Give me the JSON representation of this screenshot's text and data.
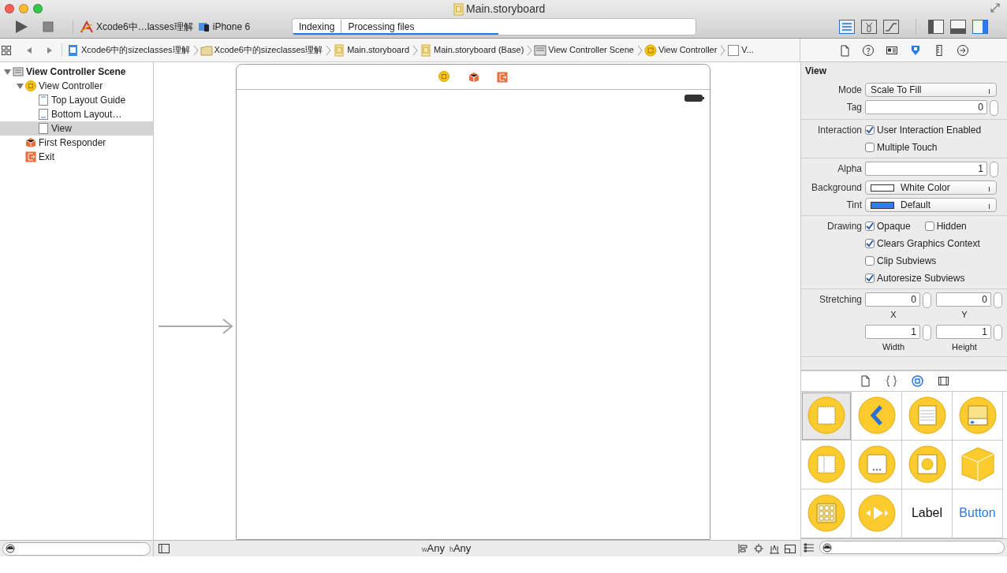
{
  "window": {
    "title": "Main.storyboard"
  },
  "toolbar": {
    "scheme": "Xcode6中…lasses理解",
    "device": "iPhone 6",
    "activity": {
      "task": "Indexing",
      "detail": "Processing files",
      "level": 0.51
    },
    "editor_modes": [
      {
        "kind": "standard",
        "selected": true
      },
      {
        "kind": "assistant",
        "selected": false
      },
      {
        "kind": "version",
        "selected": false
      }
    ],
    "panels": [
      {
        "kind": "navigator",
        "on": false
      },
      {
        "kind": "debug",
        "on": false
      },
      {
        "kind": "utilities",
        "on": true
      }
    ]
  },
  "jump_bar": [
    {
      "kind": "project",
      "text": "Xcode6中的sizeclasses理解"
    },
    {
      "kind": "folder",
      "text": "Xcode6中的sizeclasses理解"
    },
    {
      "kind": "storyboard",
      "text": "Main.storyboard"
    },
    {
      "kind": "storyboard",
      "text": "Main.storyboard (Base)"
    },
    {
      "kind": "scene",
      "text": "View Controller Scene"
    },
    {
      "kind": "controller",
      "text": "View Controller"
    },
    {
      "kind": "view",
      "text": "V..."
    }
  ],
  "inspector_tabs": [
    {
      "kind": "file",
      "selected": false
    },
    {
      "kind": "help",
      "selected": false
    },
    {
      "kind": "identity",
      "selected": false
    },
    {
      "kind": "attributes",
      "selected": true
    },
    {
      "kind": "size",
      "selected": false
    },
    {
      "kind": "connections",
      "selected": false
    }
  ],
  "outline": [
    {
      "kind": "scene",
      "text": "View Controller Scene",
      "expanded": true,
      "selected": false,
      "children": [
        {
          "kind": "controller",
          "text": "View Controller",
          "expanded": true,
          "selected": false,
          "children": [
            {
              "kind": "top-guide",
              "text": "Top Layout Guide",
              "selected": false
            },
            {
              "kind": "bottom-guide",
              "text": "Bottom Layout…",
              "selected": false
            },
            {
              "kind": "view",
              "text": "View",
              "selected": true
            }
          ]
        },
        {
          "kind": "responder",
          "text": "First Responder",
          "selected": false
        },
        {
          "kind": "exit",
          "text": "Exit",
          "selected": false
        }
      ]
    }
  ],
  "canvas": {
    "size_class": {
      "w_mark": "w",
      "width": "Any",
      "h_mark": "h",
      "height": "Any"
    }
  },
  "inspector": {
    "title": "View",
    "groups": [
      [
        {
          "kind": "popup",
          "label": "Mode",
          "value": "Scale To Fill"
        },
        {
          "kind": "stepper",
          "label": "Tag",
          "value": "0"
        }
      ],
      [
        {
          "kind": "checks",
          "label": "Interaction",
          "items": [
            {
              "text": "User Interaction Enabled",
              "checked": true
            }
          ]
        },
        {
          "kind": "checks",
          "items": [
            {
              "text": "Multiple Touch",
              "checked": false
            }
          ]
        }
      ],
      [
        {
          "kind": "stepper",
          "label": "Alpha",
          "value": "1"
        },
        {
          "kind": "popup",
          "label": "Background",
          "value": "White Color",
          "color": "#ffffff"
        },
        {
          "kind": "popup",
          "label": "Tint",
          "value": "Default",
          "color": "#2f80ed"
        }
      ],
      [
        {
          "kind": "checks",
          "label": "Drawing",
          "items": [
            {
              "text": "Opaque",
              "checked": true
            },
            {
              "text": "Hidden",
              "checked": false
            }
          ]
        },
        {
          "kind": "checks",
          "items": [
            {
              "text": "Clears Graphics Context",
              "checked": true
            }
          ]
        },
        {
          "kind": "checks",
          "items": [
            {
              "text": "Clip Subviews",
              "checked": false
            }
          ]
        },
        {
          "kind": "checks",
          "items": [
            {
              "text": "Autoresize Subviews",
              "checked": true
            }
          ]
        }
      ],
      [
        {
          "kind": "pair",
          "label": "Stretching",
          "fields": [
            {
              "value": "0",
              "caption": "X"
            },
            {
              "value": "0",
              "caption": "Y"
            }
          ]
        },
        {
          "kind": "pair",
          "fields": [
            {
              "value": "1",
              "caption": "Width"
            },
            {
              "value": "1",
              "caption": "Height"
            }
          ]
        }
      ]
    ]
  },
  "library_tabs": [
    {
      "kind": "file",
      "selected": false
    },
    {
      "kind": "snippet",
      "selected": false
    },
    {
      "kind": "object",
      "selected": true
    },
    {
      "kind": "media",
      "selected": false
    }
  ],
  "library": [
    {
      "kind": "view",
      "selected": true
    },
    {
      "kind": "navigation",
      "selected": false
    },
    {
      "kind": "table",
      "selected": false
    },
    {
      "kind": "tabbar",
      "selected": false
    },
    {
      "kind": "split",
      "selected": false
    },
    {
      "kind": "page",
      "selected": false
    },
    {
      "kind": "image",
      "selected": false
    },
    {
      "kind": "object",
      "selected": false
    },
    {
      "kind": "collection",
      "selected": false
    },
    {
      "kind": "media",
      "selected": false
    },
    {
      "kind": "label",
      "text": "Label",
      "selected": false
    },
    {
      "kind": "button",
      "text": "Button",
      "selected": false
    }
  ]
}
